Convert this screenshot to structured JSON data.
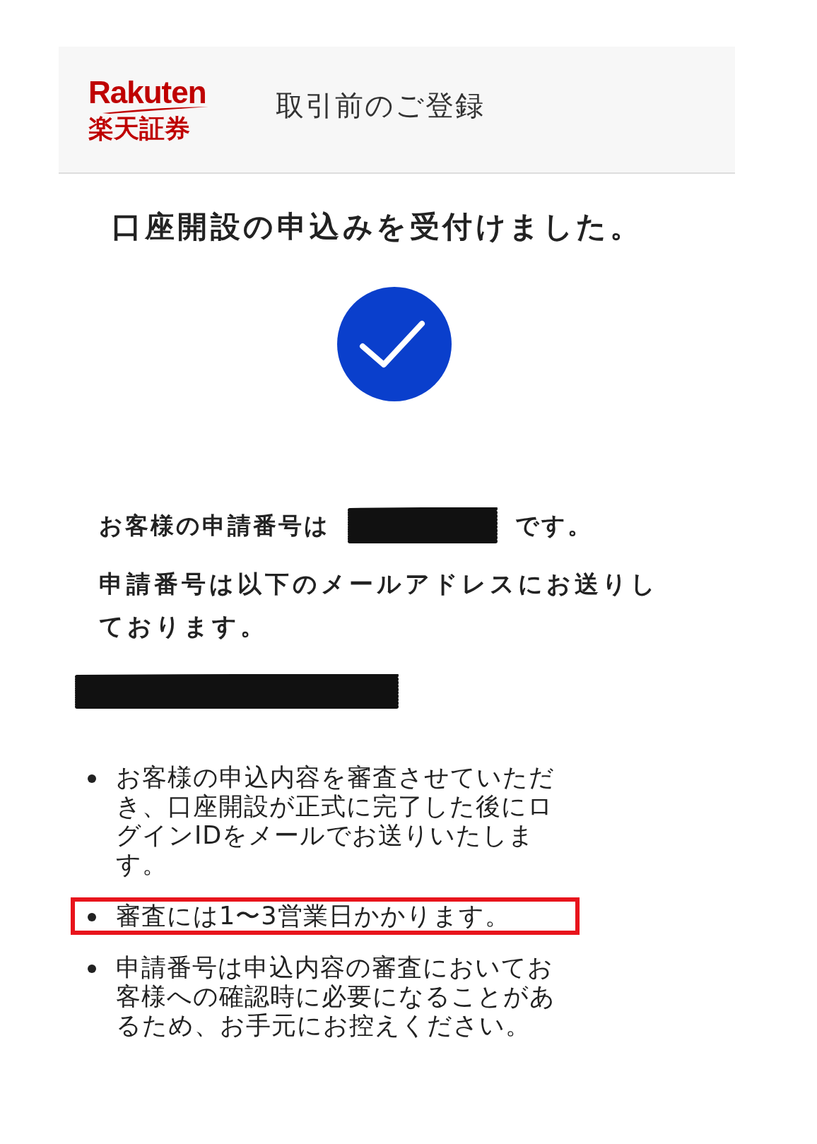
{
  "header": {
    "logo_latin": "Rakuten",
    "logo_japanese": "楽天証券",
    "title": "取引前のご登録"
  },
  "heading": "口座開設の申込みを受付けました。",
  "status": {
    "kind": "success"
  },
  "application_number_sentence": {
    "before": "お客様の申請番号は",
    "after": "です。"
  },
  "email_notice": "申請番号は以下のメールアドレスにお送りしております。",
  "notes": [
    {
      "text": "お客様の申込内容を審査させていただき、口座開設が正式に完了した後にログインIDをメールでお送りいたします。",
      "highlighted": false
    },
    {
      "text": "審査には1〜3営業日かかります。",
      "highlighted": true
    },
    {
      "text": "申請番号は申込内容の審査においてお客様への確認時に必要になることがあるため、お手元にお控えください。",
      "highlighted": false
    }
  ]
}
